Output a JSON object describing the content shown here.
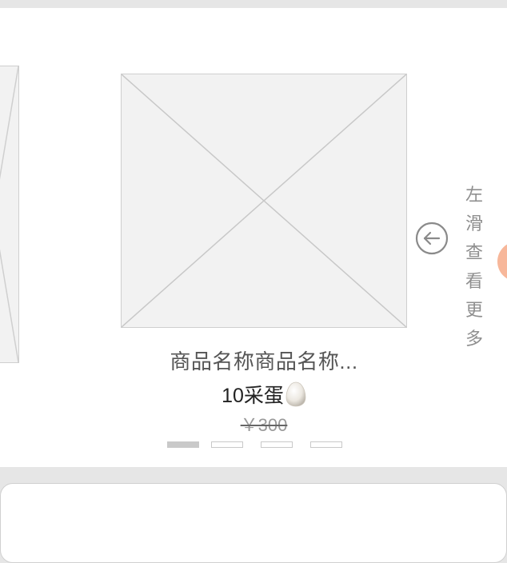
{
  "product": {
    "name": "商品名称商品名称...",
    "price_value": "10采蛋",
    "original_price": "￥300",
    "image_icon": "image-placeholder-icon",
    "currency_icon": "egg-icon"
  },
  "carousel": {
    "dots": [
      true,
      false,
      false,
      false
    ]
  },
  "swipe_hint": {
    "icon": "left-arrow-circle-icon",
    "chars": [
      "左",
      "滑",
      "查",
      "看",
      "更",
      "多"
    ]
  },
  "colors": {
    "background": "#e6e6e6",
    "card": "#ffffff",
    "placeholder": "#f2f2f2",
    "hint_text": "#8f8f8f",
    "accent_bubble": "#f7b79a"
  }
}
